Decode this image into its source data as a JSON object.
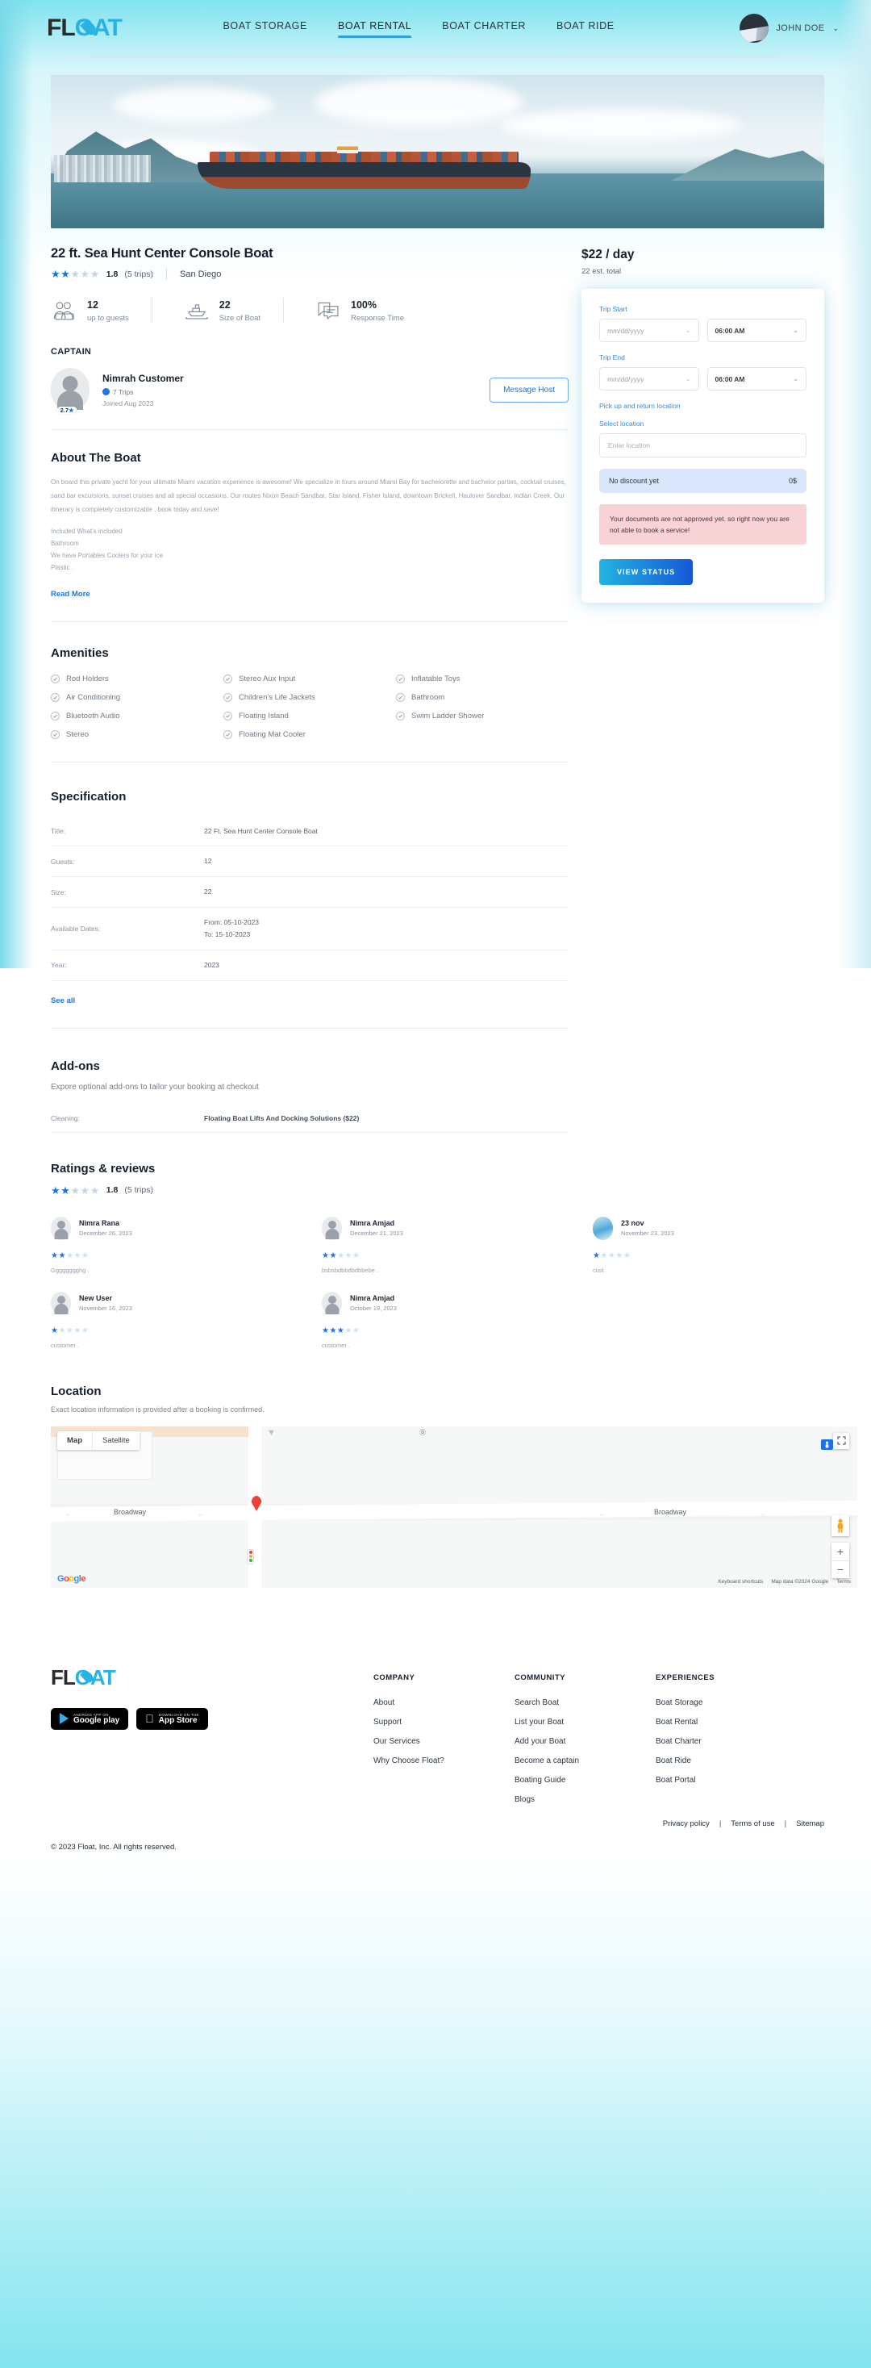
{
  "header": {
    "logo": {
      "part1": "FL",
      "part2": "O",
      "part3": "AT"
    },
    "nav": [
      {
        "label": "BOAT STORAGE",
        "active": false
      },
      {
        "label": "BOAT RENTAL",
        "active": true
      },
      {
        "label": "BOAT CHARTER",
        "active": false
      },
      {
        "label": "BOAT RIDE",
        "active": false
      }
    ],
    "user": {
      "name": "JOHN DOE",
      "caret": "⌄"
    }
  },
  "listing": {
    "title": "22 ft. Sea Hunt Center Console Boat",
    "rating_value": "1.8",
    "rating_stars_filled": 2,
    "trips": "(5 trips)",
    "location": "San Diego",
    "stats": [
      {
        "icon": "guests-icon",
        "value": "12",
        "label": "up to guests"
      },
      {
        "icon": "boat-icon",
        "value": "22",
        "label": "Size of Boat"
      },
      {
        "icon": "chat-icon",
        "value": "100%",
        "label": "Response Time"
      }
    ]
  },
  "captain": {
    "heading": "CAPTAIN",
    "name": "Nimrah Customer",
    "trips": "7 Trips",
    "joined": "Joined Aug 2023",
    "badge_rating": "2.7",
    "message_button": "Message Host"
  },
  "about": {
    "heading": "About The Boat",
    "paragraph": "On board this private yacht for your ultimate Miami vacation experience is awesome! We specialize in tours around Miami Bay for bachelorette and bachelor parties, cocktail cruises, sand bar excursions, sunset cruises and all special occasions. Our routes Nixon Beach Sandbar, Star Island, Fisher Island, downtown Brickell, Haulover Sandbar, Indian Creek. Our itinerary is completely customizable , book today and save!",
    "included": [
      "Included What's included",
      "Bathroom",
      "We have Portables Coolers for your ice",
      "Plastic ."
    ],
    "read_more": "Read More"
  },
  "amenities": {
    "heading": "Amenities",
    "items": [
      "Rod Holders",
      "Stereo Aux Input",
      "Inflatable Toys",
      "Air Conditioning",
      "Children's Life Jackets",
      "Bathroom",
      "Bluetooth Audio",
      "Floating Island",
      "Swim Ladder Shower",
      "Stereo",
      "Floating Mat Cooler"
    ]
  },
  "specification": {
    "heading": "Specification",
    "rows": [
      {
        "key": "Title:",
        "value": "22 Ft. Sea Hunt Center Console Boat"
      },
      {
        "key": "Guests:",
        "value": "12"
      },
      {
        "key": "Size:",
        "value": "22"
      },
      {
        "key": "Available Dates:",
        "value": "From: 05-10-2023\nTo: 15-10-2023"
      },
      {
        "key": "Year:",
        "value": "2023"
      }
    ],
    "see_all": "See all"
  },
  "addons": {
    "heading": "Add-ons",
    "subtitle": "Expore optional add-ons to tailor your booking at checkout",
    "rows": [
      {
        "key": "Cleaning:",
        "value": "Floating Boat Lifts And Docking Solutions ($22)"
      }
    ]
  },
  "reviews": {
    "heading": "Ratings & reviews",
    "rating_value": "1.8",
    "rating_stars_filled": 2,
    "trips": "(5 trips)",
    "items": [
      {
        "name": "Nimra Rana",
        "date": "December 26, 2023",
        "stars": 2,
        "text": "Gggggggghg .",
        "avatar": "placeholder"
      },
      {
        "name": "Nimra Amjad",
        "date": "December 21, 2023",
        "stars": 2,
        "text": "bsbsbdbbdbdbbebe .",
        "avatar": "placeholder"
      },
      {
        "name": "23 nov",
        "date": "November 23, 2023",
        "stars": 1,
        "text": "cust .",
        "avatar": "photo"
      },
      {
        "name": "New User",
        "date": "November 16, 2023",
        "stars": 1,
        "text": "customer .",
        "avatar": "placeholder"
      },
      {
        "name": "Nimra Amjad",
        "date": "October 19, 2023",
        "stars": 3,
        "text": "customer .",
        "avatar": "placeholder"
      }
    ]
  },
  "location": {
    "heading": "Location",
    "subtitle": "Exact location information is provided after a booking is confirmed.",
    "map": {
      "type_buttons": [
        {
          "label": "Map",
          "selected": true
        },
        {
          "label": "Satellite",
          "selected": false
        }
      ],
      "street_labels": [
        "Broadway",
        "Broadway"
      ],
      "watermark": "Google",
      "attribution": [
        "Keyboard shortcuts",
        "Map data ©2024 Google",
        "Terms"
      ],
      "zoom_in": "+",
      "zoom_out": "−"
    }
  },
  "booking": {
    "price": "$22 / day",
    "price_sub": "22 est. total",
    "trip_start_label": "Trip Start",
    "trip_start_date": "mm/dd/yyyy",
    "trip_start_time": "06:00 AM",
    "trip_end_label": "Trip End",
    "trip_end_date": "mm/dd/yyyy",
    "trip_end_time": "06:00 AM",
    "pickup_link": "Pick up and return location",
    "select_location_label": "Select location",
    "location_placeholder": "Enter location",
    "discount_label": "No discount yet",
    "discount_value": "0$",
    "warning": "Your documents are not approved yet. so right now you are not able to book a service!",
    "view_status_button": "VIEW STATUS"
  },
  "footer": {
    "logo": {
      "part1": "FL",
      "part2": "O",
      "part3": "AT"
    },
    "stores": [
      {
        "sub": "Android app on",
        "main": "Google play",
        "icon": "google-play-icon"
      },
      {
        "sub": "Download on the",
        "main": "App Store",
        "icon": "apple-icon"
      }
    ],
    "columns": [
      {
        "heading": "COMPANY",
        "links": [
          "About",
          "Support",
          "Our Services",
          "Why Choose Float?"
        ]
      },
      {
        "heading": "COMMUNITY",
        "links": [
          "Search Boat",
          "List your Boat",
          "Add your Boat",
          "Become a captain",
          "Boating Guide",
          "Blogs"
        ]
      },
      {
        "heading": "EXPERIENCES",
        "links": [
          "Boat Storage",
          "Boat Rental",
          "Boat Charter",
          "Boat Ride",
          "Boat Portal"
        ]
      }
    ],
    "legal": [
      "Privacy policy",
      "Terms of use",
      "Sitemap"
    ],
    "legal_sep": "|",
    "copyright": "© 2023 Float, Inc. All rights reserved."
  },
  "colors": {
    "accent": "#1a73e8",
    "brand_cyan": "#28b3e6",
    "warning_bg": "#f7d3d6",
    "discount_bg": "#d9e6fb",
    "pin": "#ea4335"
  }
}
